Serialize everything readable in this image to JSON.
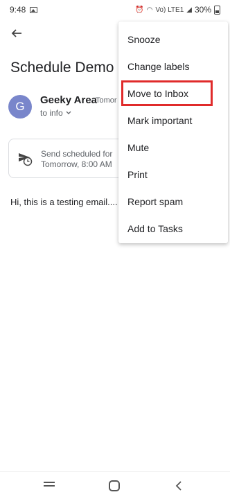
{
  "status_bar": {
    "time": "9:48",
    "network_label": "Vo) LTE1",
    "battery": "30%"
  },
  "email": {
    "subject": "Schedule Demo E",
    "sender": {
      "avatar_letter": "G",
      "name": "Geeky Area",
      "time": "Tomor",
      "recipient": "to info"
    },
    "scheduled": {
      "line1": "Send scheduled for",
      "line2": "Tomorrow, 8:00 AM"
    },
    "body": "Hi, this is a testing email...."
  },
  "menu": {
    "items": [
      {
        "label": "Snooze"
      },
      {
        "label": "Change labels"
      },
      {
        "label": "Move to Inbox",
        "highlighted": true
      },
      {
        "label": "Mark important"
      },
      {
        "label": "Mute"
      },
      {
        "label": "Print"
      },
      {
        "label": "Report spam"
      },
      {
        "label": "Add to Tasks"
      }
    ]
  },
  "colors": {
    "avatar": "#7986cb",
    "highlight_box": "#e02b2b"
  },
  "icons": {
    "back": "arrow-back-icon",
    "schedule": "scheduled-send-icon",
    "recipient_expand": "chevron-down-icon"
  }
}
